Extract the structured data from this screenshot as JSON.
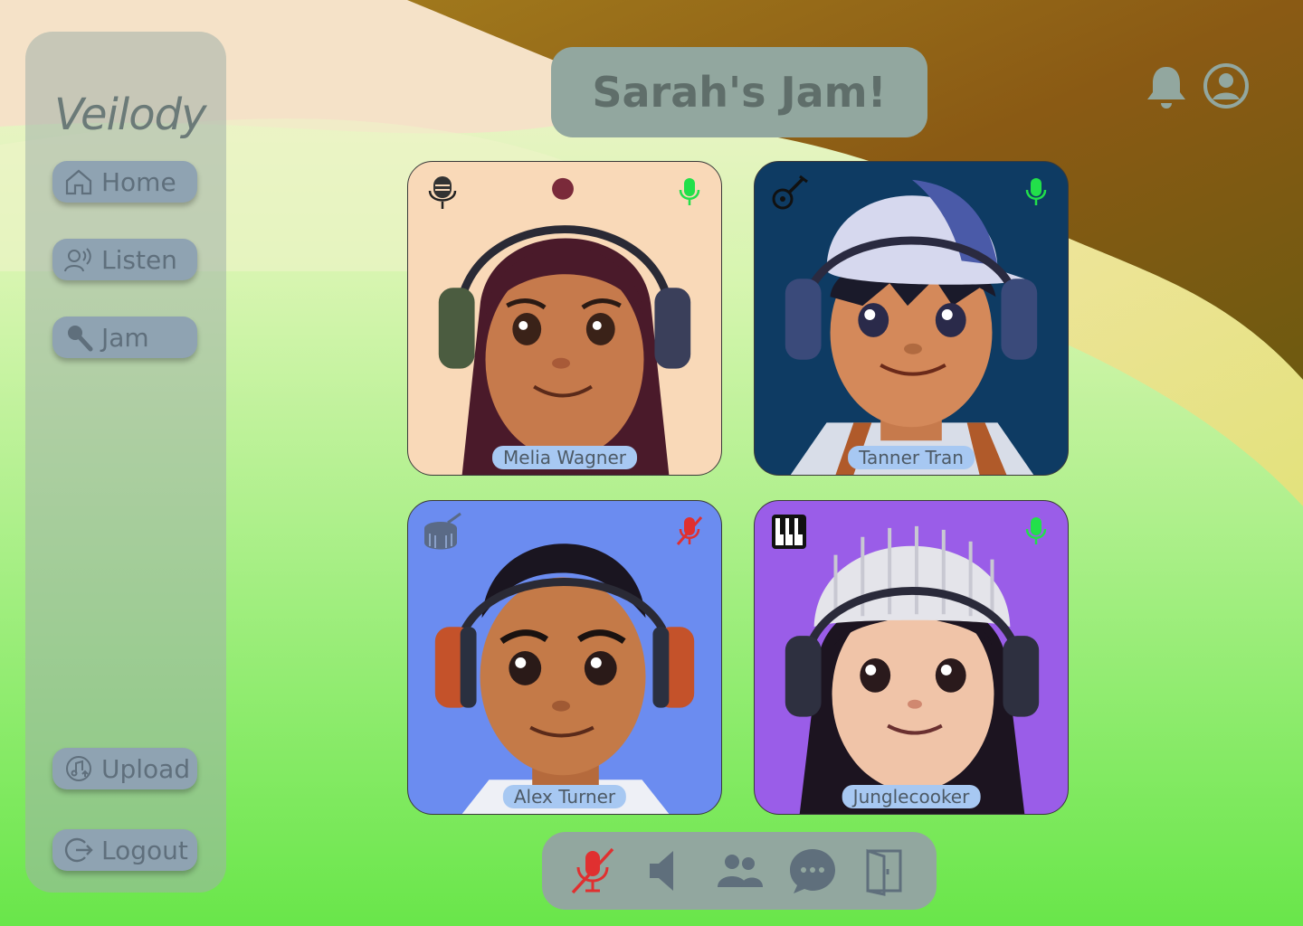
{
  "app": {
    "logo": "Veilody"
  },
  "sidebar": {
    "items": [
      {
        "label": "Home",
        "icon": "home-icon"
      },
      {
        "label": "Listen",
        "icon": "listen-icon"
      },
      {
        "label": "Jam",
        "icon": "microphone-icon"
      },
      {
        "label": "Upload",
        "icon": "upload-music-icon"
      },
      {
        "label": "Logout",
        "icon": "logout-icon"
      }
    ]
  },
  "header": {
    "title": "Sarah's Jam!",
    "icons": [
      "bell-icon",
      "user-profile-icon"
    ]
  },
  "participants": [
    {
      "name": "Melia Wagner",
      "instrument": "vocal-mic-icon",
      "mic": "on",
      "bg": "#f9d9b8"
    },
    {
      "name": "Tanner Tran",
      "instrument": "guitar-icon",
      "mic": "on",
      "bg": "#0e3b63"
    },
    {
      "name": "Alex Turner",
      "instrument": "drum-icon",
      "mic": "muted",
      "bg": "#6b8cf0"
    },
    {
      "name": "Junglecooker",
      "instrument": "piano-icon",
      "mic": "on",
      "bg": "#9a5de8"
    }
  ],
  "toolbar": {
    "buttons": [
      "mic-muted-icon",
      "speaker-icon",
      "participants-icon",
      "chat-icon",
      "leave-icon"
    ]
  },
  "colors": {
    "mic_on": "#22e04a",
    "mic_muted": "#e03030",
    "panel": "#92a79f",
    "nav_button": "#8fa3b2",
    "name_tag": "#a7c8f2"
  }
}
